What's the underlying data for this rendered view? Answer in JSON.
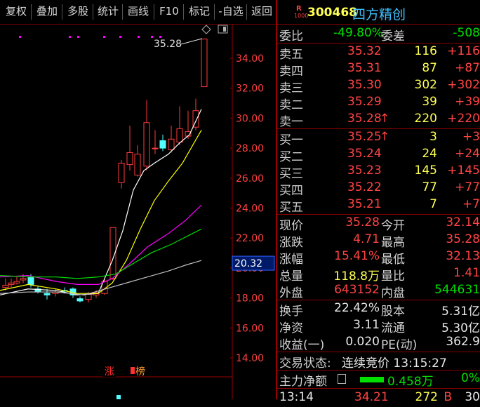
{
  "toolbar": {
    "buttons": [
      "复权",
      "叠加",
      "多股",
      "统计",
      "画线",
      "F10",
      "标记",
      "-自选",
      "返回"
    ]
  },
  "chart": {
    "peak_label": "35.28",
    "price_axis": [
      "34.00",
      "32.00",
      "30.00",
      "28.00",
      "26.00",
      "24.00",
      "22.00",
      "20.00",
      "18.00",
      "16.00",
      "14.00"
    ],
    "cursor_price": "20.32",
    "marker_zhang": "涨",
    "marker_bang": "榜",
    "colors": {
      "up": "#ff3c3c",
      "down": "#54ffff",
      "ma5": "#ffffff",
      "ma10": "#ffff00",
      "ma20": "#ff00ff",
      "ma30": "#00e000",
      "ma60": "#c0c0c0"
    }
  },
  "quote": {
    "badge_r": "R",
    "badge_n": "1000",
    "code": "300468",
    "name": "四方精创",
    "webi_label": "委比",
    "webi_value": "-49.80%",
    "weicha_label": "委差",
    "weicha_value": "-508",
    "sell": [
      {
        "label": "卖五",
        "price": "35.32",
        "vol": "116",
        "chg": "+116",
        "arrow": ""
      },
      {
        "label": "卖四",
        "price": "35.31",
        "vol": "87",
        "chg": "+87",
        "arrow": ""
      },
      {
        "label": "卖三",
        "price": "35.30",
        "vol": "302",
        "chg": "+302",
        "arrow": ""
      },
      {
        "label": "卖二",
        "price": "35.29",
        "vol": "39",
        "chg": "+39",
        "arrow": ""
      },
      {
        "label": "卖一",
        "price": "35.28",
        "vol": "220",
        "chg": "+220",
        "arrow": "↑"
      }
    ],
    "buy": [
      {
        "label": "买一",
        "price": "35.25",
        "vol": "3",
        "chg": "+3",
        "arrow": "↑"
      },
      {
        "label": "买二",
        "price": "35.24",
        "vol": "24",
        "chg": "+24",
        "arrow": ""
      },
      {
        "label": "买三",
        "price": "35.23",
        "vol": "145",
        "chg": "+145",
        "arrow": ""
      },
      {
        "label": "买四",
        "price": "35.22",
        "vol": "77",
        "chg": "+77",
        "arrow": ""
      },
      {
        "label": "买五",
        "price": "35.21",
        "vol": "7",
        "chg": "+7",
        "arrow": ""
      }
    ],
    "stats": [
      {
        "l1": "现价",
        "v1": "35.28",
        "c1": "red",
        "l2": "今开",
        "v2": "32.14",
        "c2": "red"
      },
      {
        "l1": "涨跌",
        "v1": "4.71",
        "c1": "red",
        "l2": "最高",
        "v2": "35.28",
        "c2": "red"
      },
      {
        "l1": "涨幅",
        "v1": "15.41%",
        "c1": "red",
        "l2": "最低",
        "v2": "32.13",
        "c2": "red"
      },
      {
        "l1": "总量",
        "v1": "118.8万",
        "c1": "yellow",
        "l2": "量比",
        "v2": "1.41",
        "c2": "red"
      },
      {
        "l1": "外盘",
        "v1": "643152",
        "c1": "red",
        "l2": "内盘",
        "v2": "544631",
        "c2": "green"
      }
    ],
    "stats2": [
      {
        "l1": "换手",
        "v1": "22.42%",
        "l2": "股本",
        "v2": "5.31亿"
      },
      {
        "l1": "净资",
        "v1": "3.11",
        "l2": "流通",
        "v2": "5.30亿"
      },
      {
        "l1": "收益(一)",
        "v1": "0.020",
        "l2": "PE(动)",
        "v2": "362.9"
      }
    ],
    "status_label": "交易状态:",
    "status_value": "连续竞价 13:15:27",
    "main_flow_label": "主力净额",
    "main_flow_value": "0.458万",
    "main_flow_pct": "0%",
    "tick_time": "13:14",
    "tick_price": "34.21",
    "tick_vol": "272",
    "tick_side": "B",
    "tick_count": "30"
  }
}
